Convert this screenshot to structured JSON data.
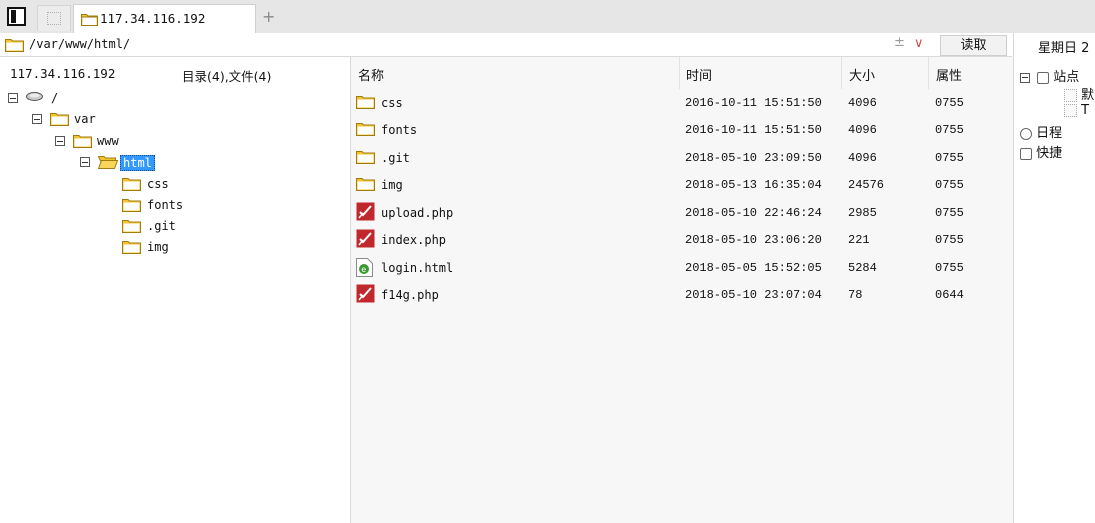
{
  "tabbar": {
    "active_tab_label": "117.34.116.192",
    "new_tab_symbol": "+"
  },
  "address": {
    "path": "/var/www/html/",
    "plusminus_symbol": "±",
    "dropdown_symbol": "∨",
    "read_button": "读取"
  },
  "left": {
    "host": "117.34.116.192",
    "summary": "目录(4),文件(4)",
    "tree": {
      "root": "/",
      "var": "var",
      "www": "www",
      "html": "html",
      "children": [
        "css",
        "fonts",
        ".git",
        "img"
      ]
    }
  },
  "files": {
    "headers": {
      "name": "名称",
      "time": "时间",
      "size": "大小",
      "attr": "属性"
    },
    "rows": [
      {
        "name": "css",
        "time": "2016-10-11 15:51:50",
        "size": "4096",
        "attr": "0755",
        "icon": "folder-icon"
      },
      {
        "name": "fonts",
        "time": "2016-10-11 15:51:50",
        "size": "4096",
        "attr": "0755",
        "icon": "folder-icon"
      },
      {
        "name": ".git",
        "time": "2018-05-10 23:09:50",
        "size": "4096",
        "attr": "0755",
        "icon": "folder-icon"
      },
      {
        "name": "img",
        "time": "2018-05-13 16:35:04",
        "size": "24576",
        "attr": "0755",
        "icon": "folder-icon"
      },
      {
        "name": "upload.php",
        "time": "2018-05-10 22:46:24",
        "size": "2985",
        "attr": "0755",
        "icon": "php-file-icon"
      },
      {
        "name": "index.php",
        "time": "2018-05-10 23:06:20",
        "size": "221",
        "attr": "0755",
        "icon": "php-file-icon"
      },
      {
        "name": "login.html",
        "time": "2018-05-05 15:52:05",
        "size": "5284",
        "attr": "0755",
        "icon": "html-file-icon"
      },
      {
        "name": "f14g.php",
        "time": "2018-05-10 23:07:04",
        "size": "78",
        "attr": "0644",
        "icon": "php-file-icon"
      }
    ]
  },
  "right": {
    "date": "星期日 2",
    "sites_label": "站点",
    "site_item_1": "默",
    "site_item_2": "T",
    "schedule_label": "日程",
    "shortcut_label": "快捷"
  },
  "colors": {
    "selection": "#3399ff",
    "folder": "#f4c430",
    "php_icon": "#c0282d",
    "html_icon": "#3a9a2f",
    "chevron": "#d34a4a"
  }
}
